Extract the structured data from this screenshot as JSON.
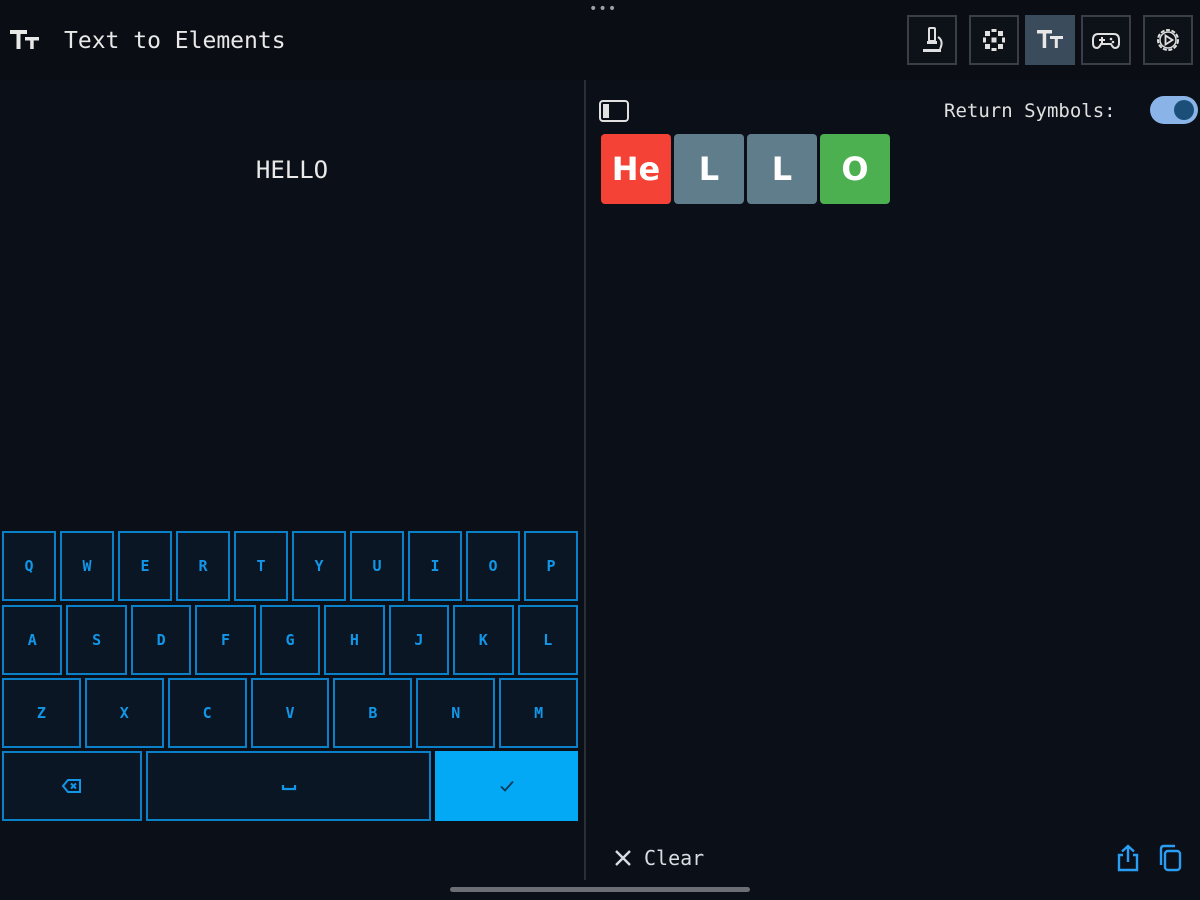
{
  "app": {
    "title": "Text to Elements",
    "toolbar": [
      {
        "name": "microscope-icon",
        "active": false
      },
      {
        "name": "periodic-grid-icon",
        "active": false
      },
      {
        "name": "text-size-icon",
        "active": true
      },
      {
        "name": "gamepad-icon",
        "active": false
      },
      {
        "name": "settings-play-icon",
        "active": false
      }
    ]
  },
  "input": {
    "text": "HELLO"
  },
  "keyboard": {
    "row1": [
      "Q",
      "W",
      "E",
      "R",
      "T",
      "Y",
      "U",
      "I",
      "O",
      "P"
    ],
    "row2": [
      "A",
      "S",
      "D",
      "F",
      "G",
      "H",
      "J",
      "K",
      "L"
    ],
    "row3": [
      "Z",
      "X",
      "C",
      "V",
      "B",
      "N",
      "M"
    ],
    "backspace_icon": "backspace-icon",
    "space_icon": "space-icon",
    "enter_icon": "checkmark-icon"
  },
  "output": {
    "return_symbols_label": "Return Symbols:",
    "return_symbols_on": true,
    "elements": [
      {
        "symbol": "He",
        "color": "#f44336"
      },
      {
        "symbol": "L",
        "color": "#607d8b"
      },
      {
        "symbol": "L",
        "color": "#607d8b"
      },
      {
        "symbol": "O",
        "color": "#4caf50"
      }
    ],
    "clear_label": "Clear"
  },
  "colors": {
    "accent": "#03a9f4",
    "key_border": "#0a80c8",
    "background": "#0b0f17"
  }
}
